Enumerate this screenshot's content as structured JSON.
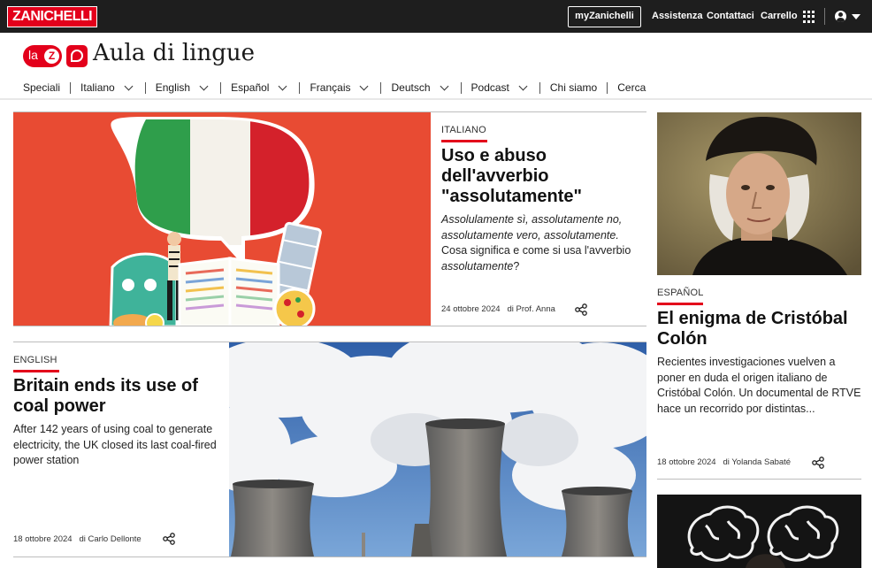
{
  "topbar": {
    "brand": "ZANICHELLI",
    "my_account": "myZanichelli",
    "links": [
      "Assistenza",
      "Contattaci",
      "Carrello"
    ]
  },
  "site": {
    "title": "Aula di lingue",
    "logo_la": "la",
    "logo_z": "Z"
  },
  "nav": [
    {
      "label": "Speciali",
      "dropdown": false
    },
    {
      "label": "Italiano",
      "dropdown": true
    },
    {
      "label": "English",
      "dropdown": true
    },
    {
      "label": "Español",
      "dropdown": true
    },
    {
      "label": "Français",
      "dropdown": true
    },
    {
      "label": "Deutsch",
      "dropdown": true
    },
    {
      "label": "Podcast",
      "dropdown": true
    },
    {
      "label": "Chi siamo",
      "dropdown": false
    },
    {
      "label": "Cerca",
      "dropdown": false
    }
  ],
  "articles": {
    "italiano": {
      "kicker": "ITALIANO",
      "title": "Uso e abuso dell'avverbio \"assolutamente\"",
      "excerpt_italic": "Assolulamente sì, assolutamente no, assolutamente vero, assolutamente.",
      "excerpt_mid": " Cosa significa e come si usa l'avverbio ",
      "excerpt_italic2": "assolutamente",
      "excerpt_end": "?",
      "date": "24 ottobre 2024",
      "author": "di Prof. Anna"
    },
    "espanol": {
      "kicker": "ESPAÑOL",
      "title": "El enigma de Cristóbal Colón",
      "excerpt": "Recientes investigaciones vuelven a poner en duda el origen italiano de Cristóbal Colón. Un documental de RTVE hace un recorrido por distintas...",
      "date": "18 ottobre 2024",
      "author": "di Yolanda Sabaté"
    },
    "english": {
      "kicker": "ENGLISH",
      "title": "Britain ends its use of coal power",
      "excerpt": "After 142 years of using coal to generate electricity, the UK closed its last coal-fired power station",
      "date": "18 ottobre 2024",
      "author": "di Carlo Dellonte"
    }
  },
  "colors": {
    "brand_red": "#e3001b",
    "topbar": "#1e1e1e"
  },
  "icons": [
    "user-icon",
    "apps-grid-icon",
    "chevron-down-icon",
    "share-icon"
  ]
}
